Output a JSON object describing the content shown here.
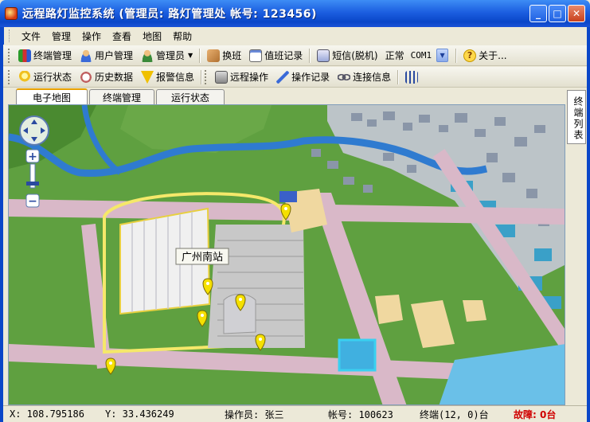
{
  "window": {
    "title": "远程路灯监控系统 (管理员: 路灯管理处  帐号: 123456)"
  },
  "menu": [
    "文件",
    "管理",
    "操作",
    "查看",
    "地图",
    "帮助"
  ],
  "toolbar1": {
    "terminal_mgmt": "终端管理",
    "user_mgmt": "用户管理",
    "admin": "管理员",
    "shift_change": "换班",
    "duty_log": "值班记录",
    "sms": "短信(脱机)",
    "status": "正常",
    "com_port": "COM1",
    "about": "关于..."
  },
  "toolbar2": {
    "run_status": "运行状态",
    "history": "历史数据",
    "alarm": "报警信息",
    "remote_op": "远程操作",
    "op_log": "操作记录",
    "conn_info": "连接信息"
  },
  "tabs": [
    "电子地图",
    "终端管理",
    "运行状态"
  ],
  "side_tab": "终端列表",
  "map": {
    "station_label": "广州南站"
  },
  "statusbar": {
    "x": "X: 108.795186",
    "y": "Y: 33.436249",
    "operator": "操作员: 张三",
    "account": "帐号: 100623",
    "terminal": "终端(12, 0)台",
    "fault": "故障: 0台"
  },
  "colors": {
    "titlebar": "#0a46c8",
    "fault": "#d00000",
    "grass": "#5fa040",
    "road": "#d9b8c8",
    "river": "#2f7bd0",
    "marker": "#f5e000"
  }
}
